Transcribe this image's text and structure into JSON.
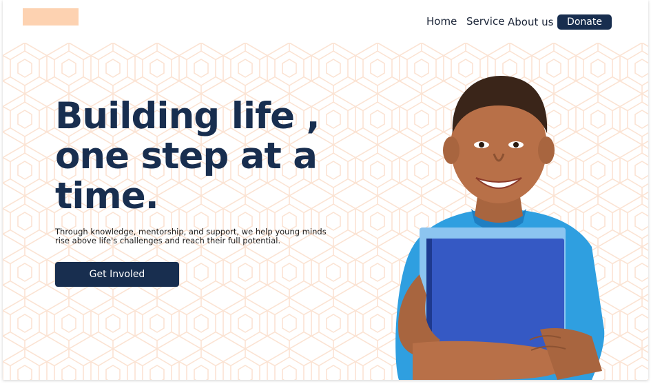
{
  "header": {
    "logo_alt": "",
    "nav": [
      {
        "label": "Home"
      },
      {
        "label": "Service"
      },
      {
        "label": "About us"
      }
    ],
    "donate_label": "Donate"
  },
  "hero": {
    "title_line1": "Building life ,",
    "title_line2": "one step at a",
    "title_line3": "time.",
    "subtitle_line1": "Through knowledge, mentorship, and support, we help young minds",
    "subtitle_line2": "rise above life's challenges and reach their full potential.",
    "cta_label": "Get Involed",
    "image_subject": "smiling boy in blue shirt holding blue book"
  },
  "colors": {
    "primary": "#182e4f",
    "accent": "#fdd2b1",
    "pattern": "#fbe3d3",
    "background": "#ffffff"
  }
}
